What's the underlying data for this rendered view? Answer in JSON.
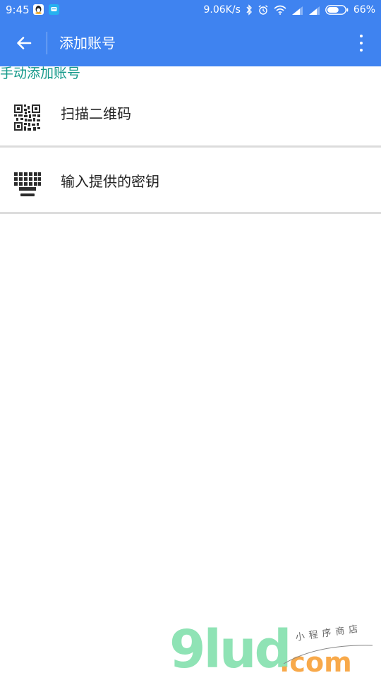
{
  "status_bar": {
    "time": "9:45",
    "network_speed": "9.06K/s",
    "battery_percent": "66%",
    "battery_level": 0.66,
    "icons": [
      "qq-icon",
      "message-icon",
      "bluetooth-icon",
      "alarm-icon",
      "wifi-icon",
      "signal-icon",
      "signal-icon",
      "battery-icon"
    ]
  },
  "app_bar": {
    "title": "添加账号",
    "back_icon": "arrow-left-icon",
    "menu_icon": "more-vert-icon"
  },
  "section": {
    "header": "手动添加账号"
  },
  "options": [
    {
      "label": "扫描二维码",
      "icon": "qr-code-icon"
    },
    {
      "label": "输入提供的密钥",
      "icon": "keyboard-icon"
    }
  ],
  "watermark": {
    "main": "9lud",
    "domain": ".com",
    "tagline": "小程序商店"
  },
  "colors": {
    "primary": "#3f83f0",
    "section_header": "#14998a",
    "divider": "#dcdcdc",
    "text": "#222222"
  }
}
